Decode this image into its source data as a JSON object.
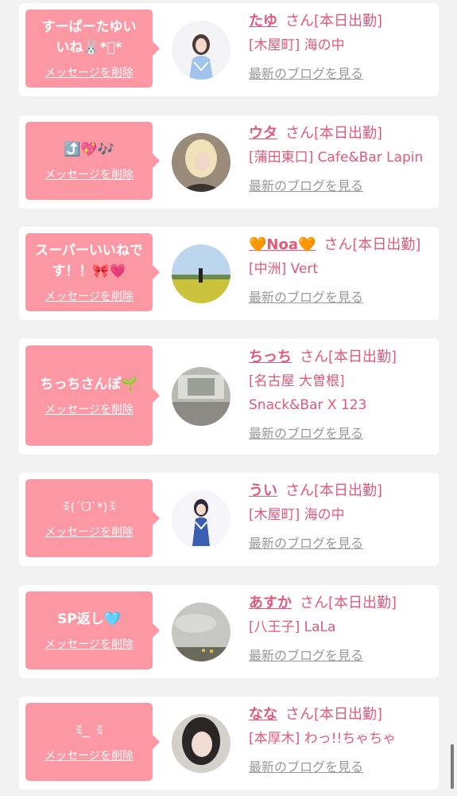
{
  "delete_label": "メッセージを削除",
  "blog_label": "最新のブログを見る",
  "san_label": "さん",
  "status_label": "[本日出勤]",
  "colors": {
    "bubble": "#fc98a4",
    "name_text": "#e05a7c",
    "link_gray": "#999999",
    "background": "#f2f2f2"
  },
  "messages": [
    {
      "message": "すーぱーたゆいいね🐰*ﾟ*",
      "name": "たゆ",
      "area": "[木屋町] 海の中",
      "avatar_icon": "girl-photo-icon"
    },
    {
      "message": "⤴️💖🎶",
      "name": "ウタ",
      "area": "[蒲田東口] Cafe&Bar Lapin",
      "avatar_icon": "blonde-girl-photo-icon"
    },
    {
      "message": "スーパーいいねです！！🎀💗",
      "name": "🧡Noa🧡",
      "area": "[中洲] Vert",
      "avatar_icon": "flower-field-photo-icon"
    },
    {
      "message": "ちっちさんぽ🌱",
      "name": "ちっち",
      "area": "[名古屋 大曽根] Snack&Bar X 123",
      "avatar_icon": "empty-room-photo-icon"
    },
    {
      "message": "ꉂ(ˊᗜˋ*)ꉂ",
      "name": "うい",
      "area": "[木屋町] 海の中",
      "avatar_icon": "idol-girl-photo-icon"
    },
    {
      "message": "SP返し🩵",
      "name": "あすか",
      "area": "[八王子] LaLa",
      "avatar_icon": "cloudy-sky-photo-icon"
    },
    {
      "message": "ꉂ ̫ ̫ ꉂ",
      "name": "なな",
      "area": "[本厚木] わっ!!ちゃちゃ",
      "avatar_icon": "selfie-girl-photo-icon"
    }
  ]
}
